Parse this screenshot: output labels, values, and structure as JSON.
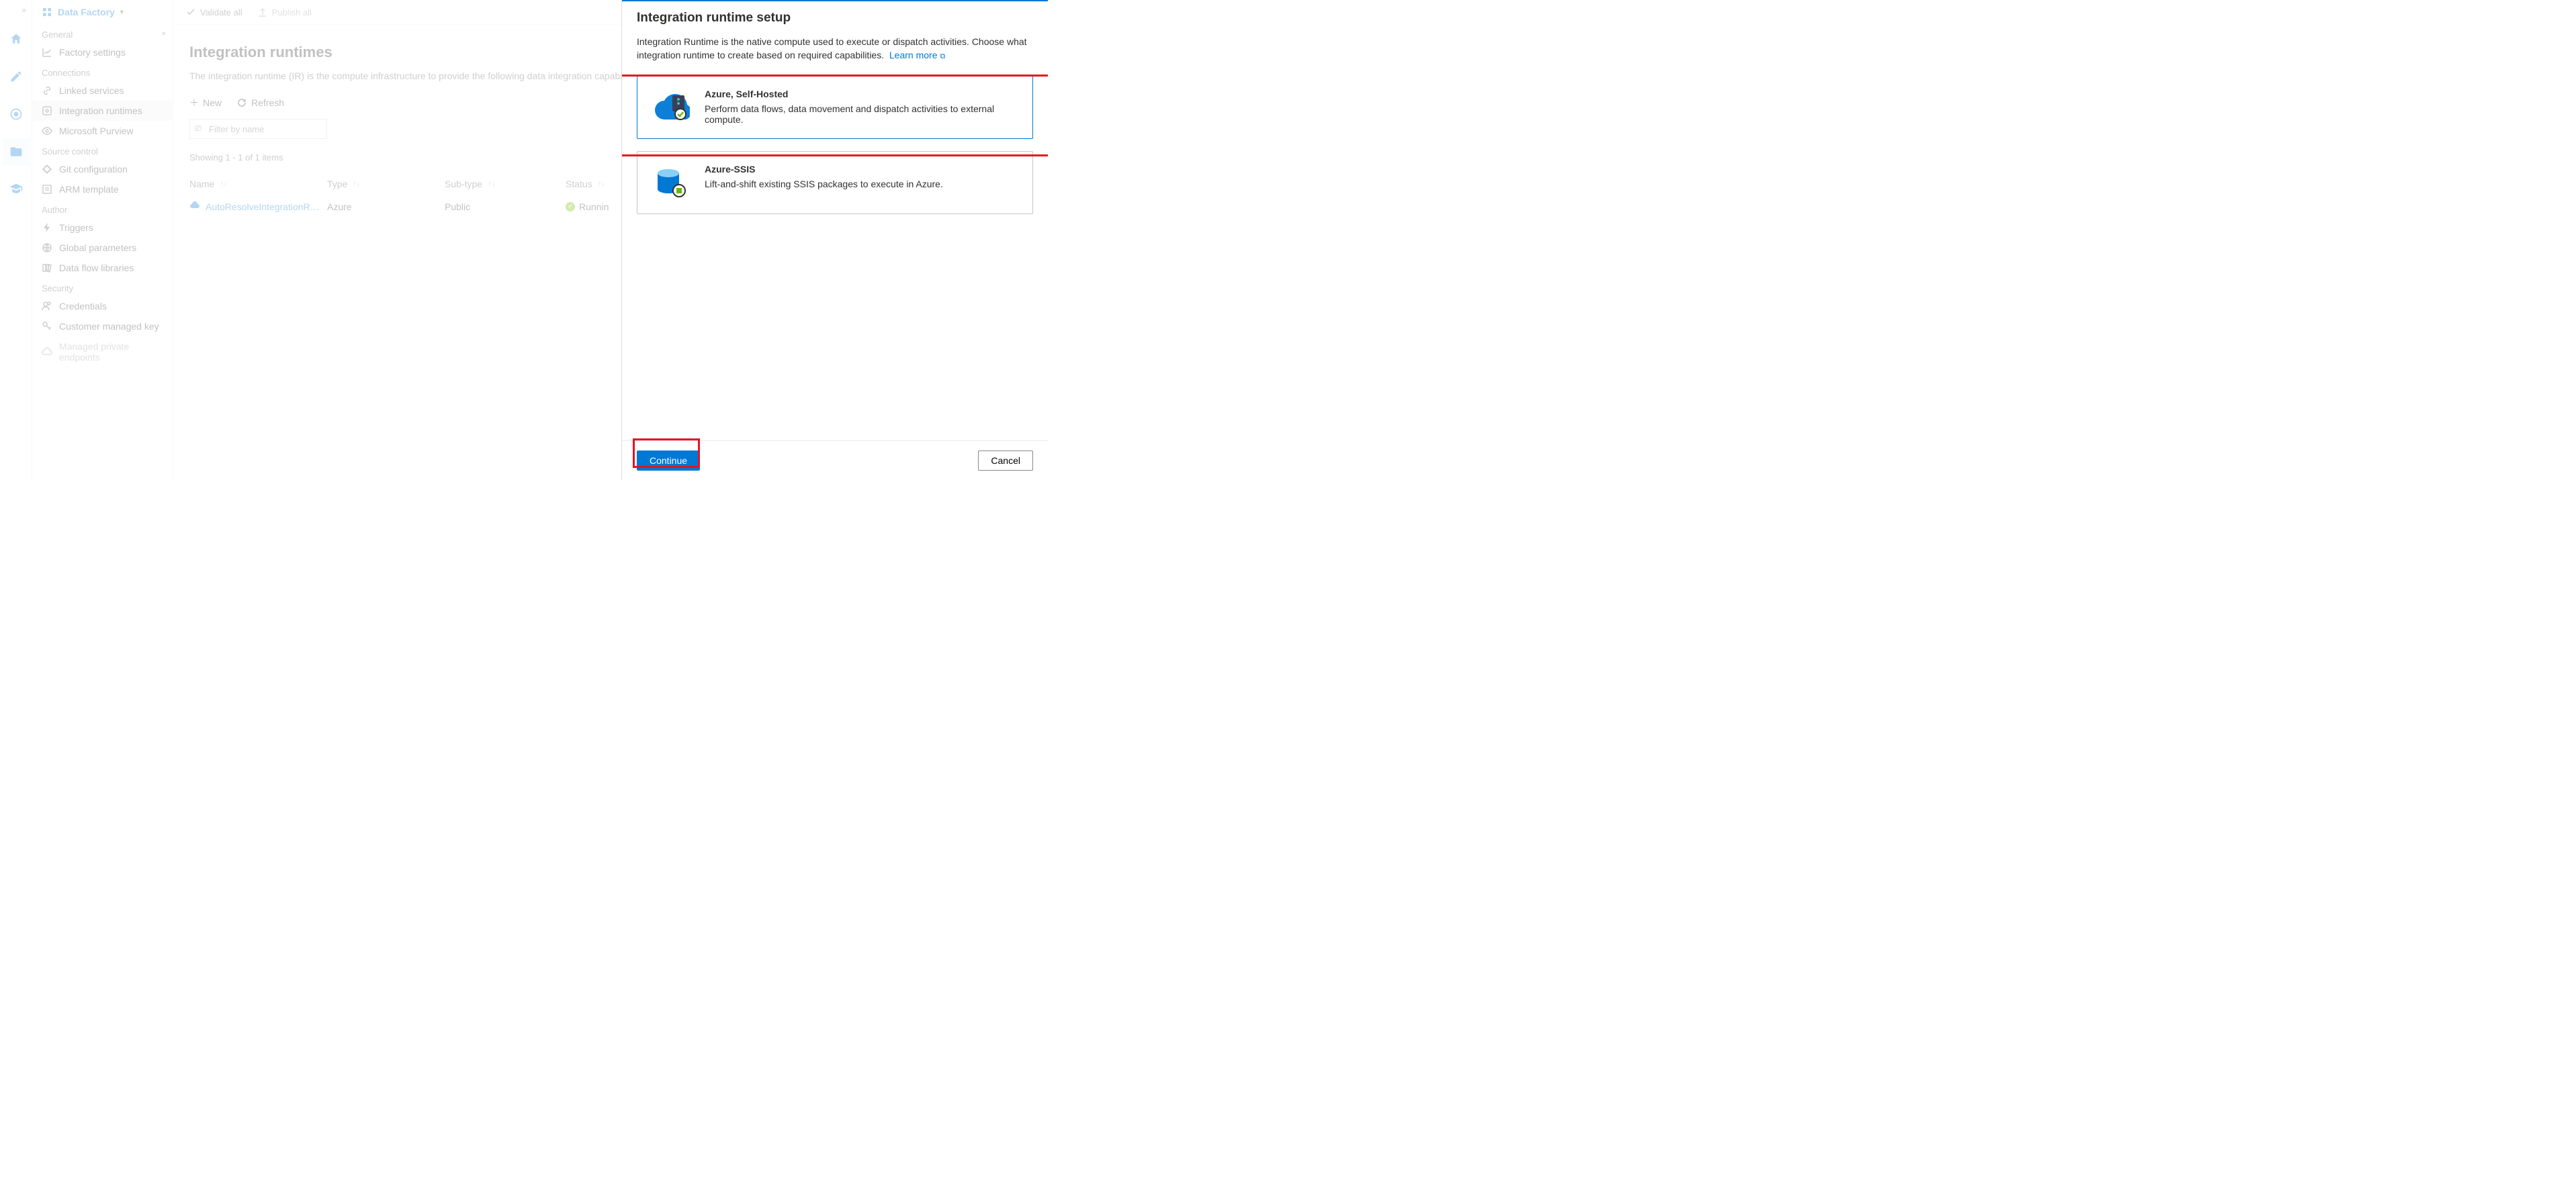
{
  "topbar": {
    "brand": "Data Factory",
    "validate": "Validate all",
    "publish": "Publish all"
  },
  "sidebar": {
    "sections": {
      "general": "General",
      "connections": "Connections",
      "source": "Source control",
      "author": "Author",
      "security": "Security"
    },
    "items": {
      "factory_settings": "Factory settings",
      "linked_services": "Linked services",
      "integration_runtimes": "Integration runtimes",
      "purview": "Microsoft Purview",
      "git": "Git configuration",
      "arm": "ARM template",
      "triggers": "Triggers",
      "global_params": "Global parameters",
      "dataflow_libs": "Data flow libraries",
      "credentials": "Credentials",
      "cmk": "Customer managed key",
      "mpe": "Managed private endpoints"
    }
  },
  "main": {
    "title": "Integration runtimes",
    "desc": "The integration runtime (IR) is the compute infrastructure to provide the following data integration capabilities",
    "actions": {
      "new": "New",
      "refresh": "Refresh"
    },
    "filter_placeholder": "Filter by name",
    "paging": "Showing 1 - 1 of 1 items",
    "cols": {
      "name": "Name",
      "type": "Type",
      "sub": "Sub-type",
      "status": "Status"
    },
    "row1": {
      "name": "AutoResolveIntegrationR…",
      "type": "Azure",
      "sub": "Public",
      "status": "Runnin"
    }
  },
  "panel": {
    "title": "Integration runtime setup",
    "desc1": "Integration Runtime is the native compute used to execute or dispatch activities. Choose what integration runtime to create based on required capabilities.",
    "learn": "Learn more",
    "opt1": {
      "title": "Azure, Self-Hosted",
      "desc": "Perform data flows, data movement and dispatch activities to external compute."
    },
    "opt2": {
      "title": "Azure-SSIS",
      "desc": "Lift-and-shift existing SSIS packages to execute in Azure."
    },
    "continue": "Continue",
    "cancel": "Cancel"
  }
}
